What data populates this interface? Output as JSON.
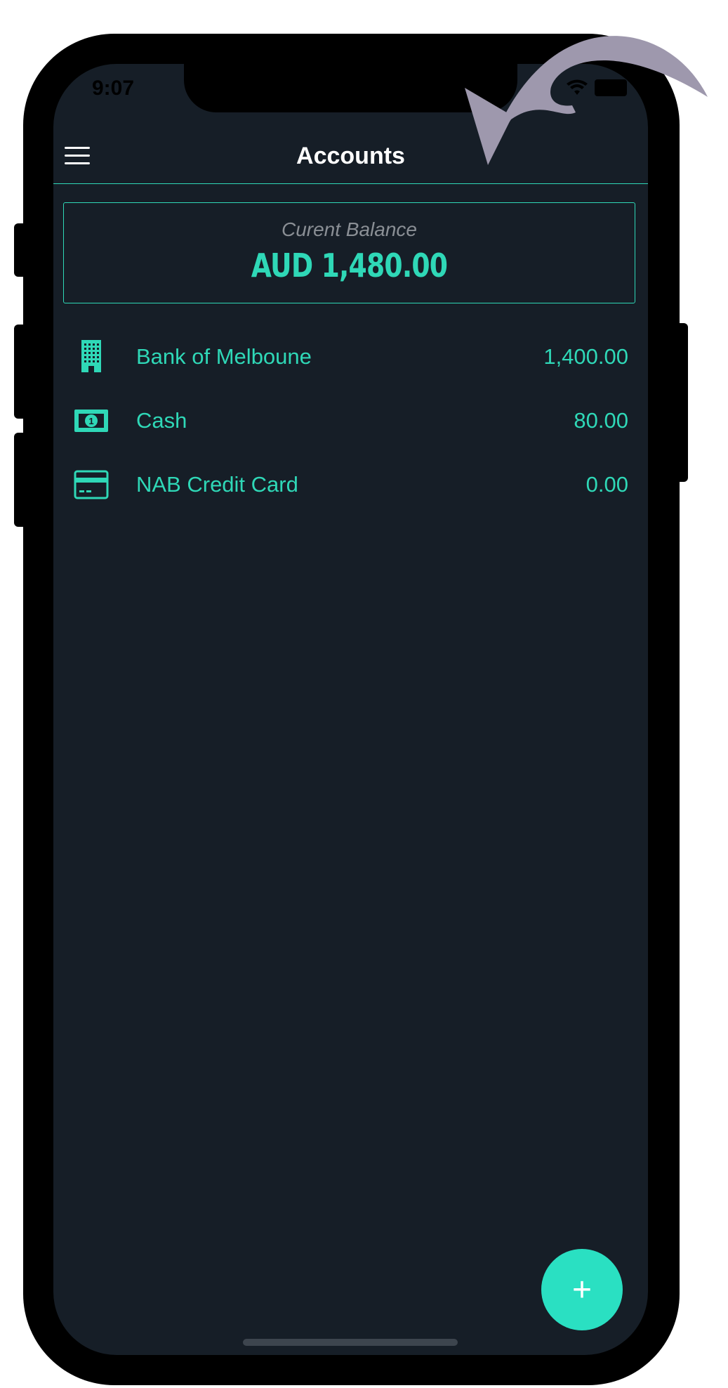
{
  "status_bar": {
    "time": "9:07"
  },
  "header": {
    "title": "Accounts",
    "menu_icon": "hamburger-menu-icon"
  },
  "balance": {
    "label": "Curent Balance",
    "value": "AUD 1,480.00"
  },
  "accounts": [
    {
      "name": "Bank of Melboune",
      "amount": "1,400.00",
      "icon": "bank-building-icon"
    },
    {
      "name": "Cash",
      "amount": "80.00",
      "icon": "cash-icon"
    },
    {
      "name": "NAB Credit Card",
      "amount": "0.00",
      "icon": "credit-card-icon"
    }
  ],
  "fab": {
    "label": "+"
  },
  "colors": {
    "accent": "#2fd8b7",
    "background": "#161e27",
    "fab": "#2ae0c2",
    "annotation_arrow": "#9e98ad"
  }
}
